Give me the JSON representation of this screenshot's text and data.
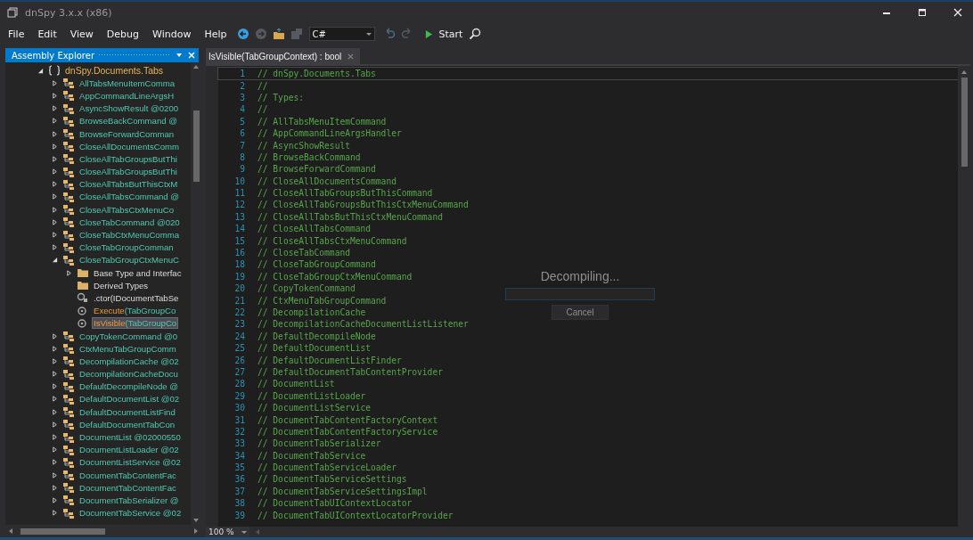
{
  "window": {
    "title": "dnSpy 3.x.x (x86)"
  },
  "menu": [
    "File",
    "Edit",
    "View",
    "Debug",
    "Window",
    "Help"
  ],
  "toolbar": {
    "language": "C#",
    "start": "Start"
  },
  "explorer": {
    "title": "Assembly Explorer",
    "tree": [
      {
        "kind": "namespace",
        "label": "dnSpy.Documents.Tabs",
        "expanded": true,
        "selected": false,
        "children": [
          {
            "kind": "class",
            "label": "AllTabsMenuItemComma",
            "expanded": false,
            "selected": false
          },
          {
            "kind": "class",
            "label": "AppCommandLineArgsH",
            "expanded": false,
            "selected": false
          },
          {
            "kind": "class",
            "label": "AsyncShowResult @0200",
            "expanded": false,
            "selected": false
          },
          {
            "kind": "class",
            "label": "BrowseBackCommand @",
            "expanded": false,
            "selected": false
          },
          {
            "kind": "class",
            "label": "BrowseForwardComman",
            "expanded": false,
            "selected": false
          },
          {
            "kind": "class",
            "label": "CloseAllDocumentsComm",
            "expanded": false,
            "selected": false
          },
          {
            "kind": "class",
            "label": "CloseAllTabGroupsButThi",
            "expanded": false,
            "selected": false
          },
          {
            "kind": "class",
            "label": "CloseAllTabGroupsButThi",
            "expanded": false,
            "selected": false
          },
          {
            "kind": "class",
            "label": "CloseAllTabsButThisCtxM",
            "expanded": false,
            "selected": false
          },
          {
            "kind": "class",
            "label": "CloseAllTabsCommand @",
            "expanded": false,
            "selected": false
          },
          {
            "kind": "class",
            "label": "CloseAllTabsCtxMenuCo",
            "expanded": false,
            "selected": false
          },
          {
            "kind": "class",
            "label": "CloseTabCommand @020",
            "expanded": false,
            "selected": false
          },
          {
            "kind": "class",
            "label": "CloseTabCtxMenuComma",
            "expanded": false,
            "selected": false
          },
          {
            "kind": "class",
            "label": "CloseTabGroupComman",
            "expanded": false,
            "selected": false
          },
          {
            "kind": "class",
            "label": "CloseTabGroupCtxMenuC",
            "expanded": true,
            "selected": false,
            "children": [
              {
                "kind": "folder",
                "label": "Base Type and Interfac",
                "expanded": false,
                "selected": false
              },
              {
                "kind": "folder",
                "label": "Derived Types",
                "selected": false
              },
              {
                "kind": "ctor",
                "label": ".ctor(IDocumentTabSe",
                "selected": false
              },
              {
                "kind": "method",
                "label": "Execute",
                "params": "(TabGroupCo",
                "selected": false
              },
              {
                "kind": "method",
                "label": "IsVisible",
                "params": "(TabGroupCo",
                "selected": true
              }
            ]
          },
          {
            "kind": "class",
            "label": "CopyTokenCommand @0",
            "expanded": false,
            "selected": false
          },
          {
            "kind": "class",
            "label": "CtxMenuTabGroupComm",
            "expanded": false,
            "selected": false
          },
          {
            "kind": "class",
            "label": "DecompilationCache @02",
            "expanded": false,
            "selected": false
          },
          {
            "kind": "class",
            "label": "DecompilationCacheDocu",
            "expanded": false,
            "selected": false
          },
          {
            "kind": "class",
            "label": "DefaultDecompileNode @",
            "expanded": false,
            "selected": false
          },
          {
            "kind": "class",
            "label": "DefaultDocumentList @02",
            "expanded": false,
            "selected": false
          },
          {
            "kind": "class",
            "label": "DefaultDocumentListFind",
            "expanded": false,
            "selected": false
          },
          {
            "kind": "class",
            "label": "DefaultDocumentTabCon",
            "expanded": false,
            "selected": false
          },
          {
            "kind": "class",
            "label": "DocumentList @02000550",
            "expanded": false,
            "selected": false
          },
          {
            "kind": "class",
            "label": "DocumentListLoader @02",
            "expanded": false,
            "selected": false
          },
          {
            "kind": "class",
            "label": "DocumentListService @02",
            "expanded": false,
            "selected": false
          },
          {
            "kind": "class",
            "label": "DocumentTabContentFac",
            "expanded": false,
            "selected": false
          },
          {
            "kind": "class",
            "label": "DocumentTabContentFac",
            "expanded": false,
            "selected": false
          },
          {
            "kind": "class",
            "label": "DocumentTabSerializer @",
            "expanded": false,
            "selected": false
          },
          {
            "kind": "class",
            "label": "DocumentTabService @02",
            "expanded": false,
            "selected": false
          }
        ]
      }
    ]
  },
  "editor": {
    "tab": "IsVisible(TabGroupContext) : bool",
    "lines": [
      {
        "n": "1",
        "text": "// dnSpy.Documents.Tabs"
      },
      {
        "n": "2",
        "text": "//"
      },
      {
        "n": "3",
        "text": "// Types:"
      },
      {
        "n": "4",
        "text": "//"
      },
      {
        "n": "5",
        "text": "// AllTabsMenuItemCommand"
      },
      {
        "n": "6",
        "text": "// AppCommandLineArgsHandler"
      },
      {
        "n": "7",
        "text": "// AsyncShowResult"
      },
      {
        "n": "8",
        "text": "// BrowseBackCommand"
      },
      {
        "n": "9",
        "text": "// BrowseForwardCommand"
      },
      {
        "n": "10",
        "text": "// CloseAllDocumentsCommand"
      },
      {
        "n": "11",
        "text": "// CloseAllTabGroupsButThisCommand"
      },
      {
        "n": "12",
        "text": "// CloseAllTabGroupsButThisCtxMenuCommand"
      },
      {
        "n": "13",
        "text": "// CloseAllTabsButThisCtxMenuCommand"
      },
      {
        "n": "14",
        "text": "// CloseAllTabsCommand"
      },
      {
        "n": "15",
        "text": "// CloseAllTabsCtxMenuCommand"
      },
      {
        "n": "16",
        "text": "// CloseTabCommand"
      },
      {
        "n": "18",
        "text": "// CloseTabGroupCommand"
      },
      {
        "n": "19",
        "text": "// CloseTabGroupCtxMenuCommand"
      },
      {
        "n": "20",
        "text": "// CopyTokenCommand"
      },
      {
        "n": "21",
        "text": "// CtxMenuTabGroupCommand"
      },
      {
        "n": "22",
        "text": "// DecompilationCache"
      },
      {
        "n": "23",
        "text": "// DecompilationCacheDocumentListListener"
      },
      {
        "n": "24",
        "text": "// DefaultDecompileNode"
      },
      {
        "n": "25",
        "text": "// DefaultDocumentList"
      },
      {
        "n": "26",
        "text": "// DefaultDocumentListFinder"
      },
      {
        "n": "27",
        "text": "// DefaultDocumentTabContentProvider"
      },
      {
        "n": "28",
        "text": "// DocumentList"
      },
      {
        "n": "29",
        "text": "// DocumentListLoader"
      },
      {
        "n": "30",
        "text": "// DocumentListService"
      },
      {
        "n": "31",
        "text": "// DocumentTabContentFactoryContext"
      },
      {
        "n": "32",
        "text": "// DocumentTabContentFactoryService"
      },
      {
        "n": "33",
        "text": "// DocumentTabSerializer"
      },
      {
        "n": "34",
        "text": "// DocumentTabService"
      },
      {
        "n": "35",
        "text": "// DocumentTabServiceLoader"
      },
      {
        "n": "36",
        "text": "// DocumentTabServiceSettings"
      },
      {
        "n": "37",
        "text": "// DocumentTabServiceSettingsImpl"
      },
      {
        "n": "38",
        "text": "// DocumentTabUIContextLocator"
      },
      {
        "n": "39",
        "text": "// DocumentTabUIContextLocatorProvider"
      }
    ],
    "overlay": {
      "message": "Decompiling...",
      "level": 0,
      "cancel": "Cancel"
    },
    "zoom": "100 %"
  }
}
